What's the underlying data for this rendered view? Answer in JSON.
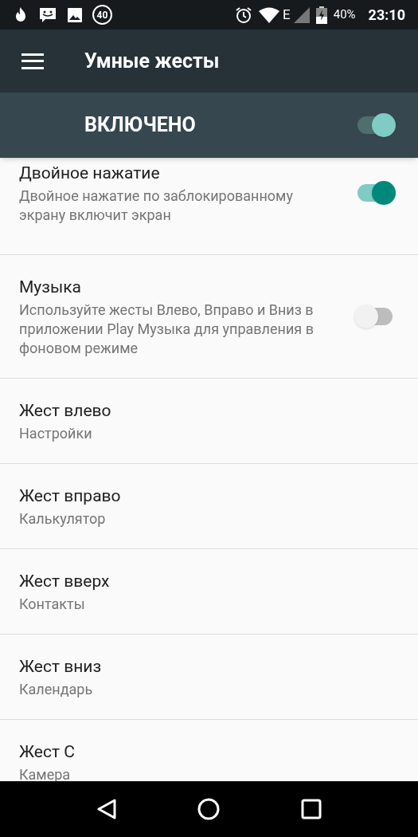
{
  "status_bar": {
    "badge": "40",
    "network": "E",
    "battery": "40%",
    "time": "23:10"
  },
  "app_bar": {
    "title": "Умные жесты"
  },
  "master": {
    "label": "ВКЛЮЧЕНО",
    "on": true
  },
  "items": [
    {
      "kind": "switch",
      "title": "Двойное нажатие",
      "summary": "Двойное нажатие по заблокированному экрану включит экран",
      "on": true
    },
    {
      "kind": "switch",
      "title": "Музыка",
      "summary": "Используйте жесты Влево, Вправо и Вниз в приложении Play Музыка для управления в фоновом режиме",
      "on": false
    },
    {
      "kind": "plain",
      "title": "Жест влево",
      "summary": "Настройки"
    },
    {
      "kind": "plain",
      "title": "Жест вправо",
      "summary": "Калькулятор"
    },
    {
      "kind": "plain",
      "title": "Жест вверх",
      "summary": "Контакты"
    },
    {
      "kind": "plain",
      "title": "Жест вниз",
      "summary": "Календарь"
    },
    {
      "kind": "plain",
      "title": "Жест C",
      "summary": "Камера"
    }
  ]
}
